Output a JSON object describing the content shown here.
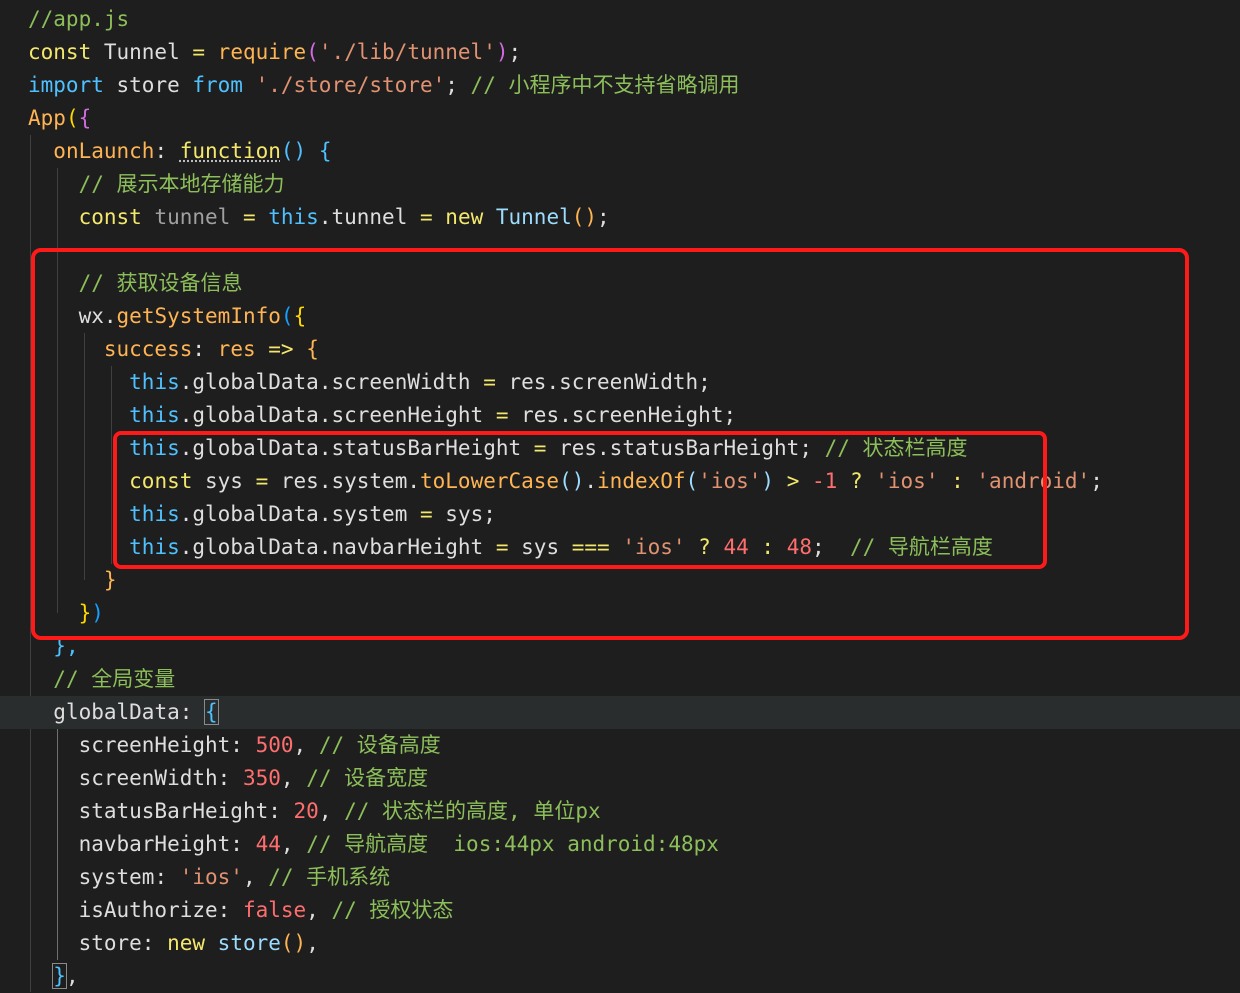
{
  "colors": {
    "background": "#1e1e1e",
    "comment": "#6a9955",
    "keyword": "#569cd6",
    "control": "#c586c0",
    "function": "#dcdcaa",
    "string": "#ce9178",
    "variable": "#9cdcfe",
    "plain": "#d4d4d4",
    "number": "#b5cea8",
    "brace_yellow": "#ffd700",
    "brace_pink": "#da70d6",
    "brace_blue": "#179fff",
    "highlight_box": "#ff1a1a"
  },
  "palette": {
    "c": "#8cbf5a",
    "k": "#4fc1ff",
    "y": "#f4e86c",
    "o": "#ffb454",
    "v": "#9cdcfe",
    "d": "#dedede",
    "s": "#e09271",
    "r": "#ff6e6e",
    "b": "#179fff",
    "g": "#a0a0a0",
    "p": "#d16ce0",
    "Y": "#ffd700",
    "t": "#ffffff"
  },
  "code_lines": [
    {
      "indent": 0,
      "tokens": [
        {
          "t": "//app.js",
          "c": "c"
        }
      ]
    },
    {
      "indent": 0,
      "tokens": [
        {
          "t": "const ",
          "c": "y"
        },
        {
          "t": "Tunnel ",
          "c": "d"
        },
        {
          "t": "= ",
          "c": "y"
        },
        {
          "t": "require",
          "c": "o"
        },
        {
          "t": "(",
          "c": "p"
        },
        {
          "t": "'./lib/tunnel'",
          "c": "s"
        },
        {
          "t": ")",
          "c": "p"
        },
        {
          "t": ";",
          "c": "d"
        }
      ]
    },
    {
      "indent": 0,
      "tokens": [
        {
          "t": "import ",
          "c": "k"
        },
        {
          "t": "store ",
          "c": "d"
        },
        {
          "t": "from ",
          "c": "k"
        },
        {
          "t": "'./store/store'",
          "c": "s"
        },
        {
          "t": "; ",
          "c": "d"
        },
        {
          "t": "// 小程序中不支持省略调用",
          "c": "c"
        }
      ]
    },
    {
      "indent": 0,
      "tokens": [
        {
          "t": "App",
          "c": "o"
        },
        {
          "t": "(",
          "c": "Y"
        },
        {
          "t": "{",
          "c": "p"
        }
      ]
    },
    {
      "indent": 1,
      "tokens": [
        {
          "t": "onLaunch",
          "c": "o"
        },
        {
          "t": ": ",
          "c": "d"
        },
        {
          "t": "function",
          "c": "y",
          "squiggle": true
        },
        {
          "t": "() ",
          "c": "k"
        },
        {
          "t": "{",
          "c": "k"
        }
      ]
    },
    {
      "indent": 2,
      "tokens": [
        {
          "t": "// 展示本地存储能力",
          "c": "c"
        }
      ]
    },
    {
      "indent": 2,
      "tokens": [
        {
          "t": "const ",
          "c": "y"
        },
        {
          "t": "tunnel ",
          "c": "g"
        },
        {
          "t": "= ",
          "c": "y"
        },
        {
          "t": "this",
          "c": "k"
        },
        {
          "t": ".",
          "c": "d"
        },
        {
          "t": "tunnel ",
          "c": "d"
        },
        {
          "t": "= ",
          "c": "y"
        },
        {
          "t": "new ",
          "c": "y"
        },
        {
          "t": "Tunnel",
          "c": "v"
        },
        {
          "t": "()",
          "c": "o"
        },
        {
          "t": ";",
          "c": "d"
        }
      ]
    },
    {
      "indent": 0,
      "tokens": []
    },
    {
      "indent": 2,
      "tokens": [
        {
          "t": "// 获取设备信息",
          "c": "c"
        }
      ]
    },
    {
      "indent": 2,
      "tokens": [
        {
          "t": "wx",
          "c": "d"
        },
        {
          "t": ".",
          "c": "d"
        },
        {
          "t": "getSystemInfo",
          "c": "o"
        },
        {
          "t": "(",
          "c": "b"
        },
        {
          "t": "{",
          "c": "Y"
        }
      ]
    },
    {
      "indent": 3,
      "tokens": [
        {
          "t": "success",
          "c": "o"
        },
        {
          "t": ": ",
          "c": "d"
        },
        {
          "t": "res ",
          "c": "o"
        },
        {
          "t": "=> ",
          "c": "y"
        },
        {
          "t": "{",
          "c": "o"
        }
      ]
    },
    {
      "indent": 4,
      "tokens": [
        {
          "t": "this",
          "c": "k"
        },
        {
          "t": ".",
          "c": "d"
        },
        {
          "t": "globalData",
          "c": "d"
        },
        {
          "t": ".",
          "c": "d"
        },
        {
          "t": "screenWidth ",
          "c": "d"
        },
        {
          "t": "= ",
          "c": "y"
        },
        {
          "t": "res",
          "c": "d"
        },
        {
          "t": ".",
          "c": "d"
        },
        {
          "t": "screenWidth",
          "c": "d"
        },
        {
          "t": ";",
          "c": "d"
        }
      ]
    },
    {
      "indent": 4,
      "tokens": [
        {
          "t": "this",
          "c": "k"
        },
        {
          "t": ".",
          "c": "d"
        },
        {
          "t": "globalData",
          "c": "d"
        },
        {
          "t": ".",
          "c": "d"
        },
        {
          "t": "screenHeight ",
          "c": "d"
        },
        {
          "t": "= ",
          "c": "y"
        },
        {
          "t": "res",
          "c": "d"
        },
        {
          "t": ".",
          "c": "d"
        },
        {
          "t": "screenHeight",
          "c": "d"
        },
        {
          "t": ";",
          "c": "d"
        }
      ]
    },
    {
      "indent": 4,
      "tokens": [
        {
          "t": "this",
          "c": "k"
        },
        {
          "t": ".",
          "c": "d"
        },
        {
          "t": "globalData",
          "c": "d"
        },
        {
          "t": ".",
          "c": "d"
        },
        {
          "t": "statusBarHeight ",
          "c": "d"
        },
        {
          "t": "= ",
          "c": "y"
        },
        {
          "t": "res",
          "c": "d"
        },
        {
          "t": ".",
          "c": "d"
        },
        {
          "t": "statusBarHeight",
          "c": "d"
        },
        {
          "t": "; ",
          "c": "d"
        },
        {
          "t": "// 状态栏高度",
          "c": "c"
        }
      ]
    },
    {
      "indent": 4,
      "tokens": [
        {
          "t": "const ",
          "c": "y"
        },
        {
          "t": "sys ",
          "c": "d"
        },
        {
          "t": "= ",
          "c": "y"
        },
        {
          "t": "res",
          "c": "d"
        },
        {
          "t": ".",
          "c": "d"
        },
        {
          "t": "system",
          "c": "d"
        },
        {
          "t": ".",
          "c": "d"
        },
        {
          "t": "toLowerCase",
          "c": "o"
        },
        {
          "t": "()",
          "c": "v"
        },
        {
          "t": ".",
          "c": "d"
        },
        {
          "t": "indexOf",
          "c": "o"
        },
        {
          "t": "(",
          "c": "v"
        },
        {
          "t": "'ios'",
          "c": "s"
        },
        {
          "t": ") ",
          "c": "v"
        },
        {
          "t": "> ",
          "c": "y"
        },
        {
          "t": "-1 ",
          "c": "r"
        },
        {
          "t": "? ",
          "c": "y"
        },
        {
          "t": "'ios' ",
          "c": "s"
        },
        {
          "t": ": ",
          "c": "y"
        },
        {
          "t": "'android'",
          "c": "s"
        },
        {
          "t": ";",
          "c": "d"
        }
      ]
    },
    {
      "indent": 4,
      "tokens": [
        {
          "t": "this",
          "c": "k"
        },
        {
          "t": ".",
          "c": "d"
        },
        {
          "t": "globalData",
          "c": "d"
        },
        {
          "t": ".",
          "c": "d"
        },
        {
          "t": "system ",
          "c": "d"
        },
        {
          "t": "= ",
          "c": "y"
        },
        {
          "t": "sys",
          "c": "d"
        },
        {
          "t": ";",
          "c": "d"
        }
      ]
    },
    {
      "indent": 4,
      "tokens": [
        {
          "t": "this",
          "c": "k"
        },
        {
          "t": ".",
          "c": "d"
        },
        {
          "t": "globalData",
          "c": "d"
        },
        {
          "t": ".",
          "c": "d"
        },
        {
          "t": "navbarHeight ",
          "c": "d"
        },
        {
          "t": "= ",
          "c": "y"
        },
        {
          "t": "sys ",
          "c": "d"
        },
        {
          "t": "=== ",
          "c": "y"
        },
        {
          "t": "'ios' ",
          "c": "s"
        },
        {
          "t": "? ",
          "c": "y"
        },
        {
          "t": "44 ",
          "c": "r"
        },
        {
          "t": ": ",
          "c": "y"
        },
        {
          "t": "48",
          "c": "r"
        },
        {
          "t": ";  ",
          "c": "d"
        },
        {
          "t": "// 导航栏高度",
          "c": "c"
        }
      ]
    },
    {
      "indent": 3,
      "tokens": [
        {
          "t": "}",
          "c": "o"
        }
      ]
    },
    {
      "indent": 2,
      "tokens": [
        {
          "t": "}",
          "c": "Y"
        },
        {
          "t": ")",
          "c": "b"
        }
      ]
    },
    {
      "indent": 1,
      "tokens": [
        {
          "t": "},",
          "c": "k"
        }
      ]
    },
    {
      "indent": 1,
      "tokens": [
        {
          "t": "// 全局变量",
          "c": "c"
        }
      ]
    },
    {
      "indent": 1,
      "current": true,
      "tokens": [
        {
          "t": "globalData",
          "c": "d"
        },
        {
          "t": ": ",
          "c": "d"
        },
        {
          "t": "{",
          "c": "k",
          "bracket": true
        }
      ]
    },
    {
      "indent": 2,
      "tokens": [
        {
          "t": "screenHeight",
          "c": "d"
        },
        {
          "t": ": ",
          "c": "d"
        },
        {
          "t": "500",
          "c": "r"
        },
        {
          "t": ", ",
          "c": "d"
        },
        {
          "t": "// 设备高度",
          "c": "c"
        }
      ]
    },
    {
      "indent": 2,
      "tokens": [
        {
          "t": "screenWidth",
          "c": "d"
        },
        {
          "t": ": ",
          "c": "d"
        },
        {
          "t": "350",
          "c": "r"
        },
        {
          "t": ", ",
          "c": "d"
        },
        {
          "t": "// 设备宽度",
          "c": "c"
        }
      ]
    },
    {
      "indent": 2,
      "tokens": [
        {
          "t": "statusBarHeight",
          "c": "d"
        },
        {
          "t": ": ",
          "c": "d"
        },
        {
          "t": "20",
          "c": "r"
        },
        {
          "t": ", ",
          "c": "d"
        },
        {
          "t": "// 状态栏的高度, 单位px",
          "c": "c"
        }
      ]
    },
    {
      "indent": 2,
      "tokens": [
        {
          "t": "navbarHeight",
          "c": "d"
        },
        {
          "t": ": ",
          "c": "d"
        },
        {
          "t": "44",
          "c": "r"
        },
        {
          "t": ", ",
          "c": "d"
        },
        {
          "t": "// 导航高度  ios:44px android:48px",
          "c": "c"
        }
      ]
    },
    {
      "indent": 2,
      "tokens": [
        {
          "t": "system",
          "c": "d"
        },
        {
          "t": ": ",
          "c": "d"
        },
        {
          "t": "'ios'",
          "c": "s"
        },
        {
          "t": ", ",
          "c": "d"
        },
        {
          "t": "// 手机系统",
          "c": "c"
        }
      ]
    },
    {
      "indent": 2,
      "tokens": [
        {
          "t": "isAuthorize",
          "c": "d"
        },
        {
          "t": ": ",
          "c": "d"
        },
        {
          "t": "false",
          "c": "r"
        },
        {
          "t": ", ",
          "c": "d"
        },
        {
          "t": "// 授权状态",
          "c": "c"
        }
      ]
    },
    {
      "indent": 2,
      "tokens": [
        {
          "t": "store",
          "c": "d"
        },
        {
          "t": ": ",
          "c": "d"
        },
        {
          "t": "new ",
          "c": "y"
        },
        {
          "t": "store",
          "c": "v"
        },
        {
          "t": "()",
          "c": "o"
        },
        {
          "t": ",",
          "c": "d"
        }
      ]
    },
    {
      "indent": 1,
      "tokens": [
        {
          "t": "}",
          "c": "k",
          "bracket": true
        },
        {
          "t": ",",
          "c": "d"
        }
      ]
    }
  ]
}
